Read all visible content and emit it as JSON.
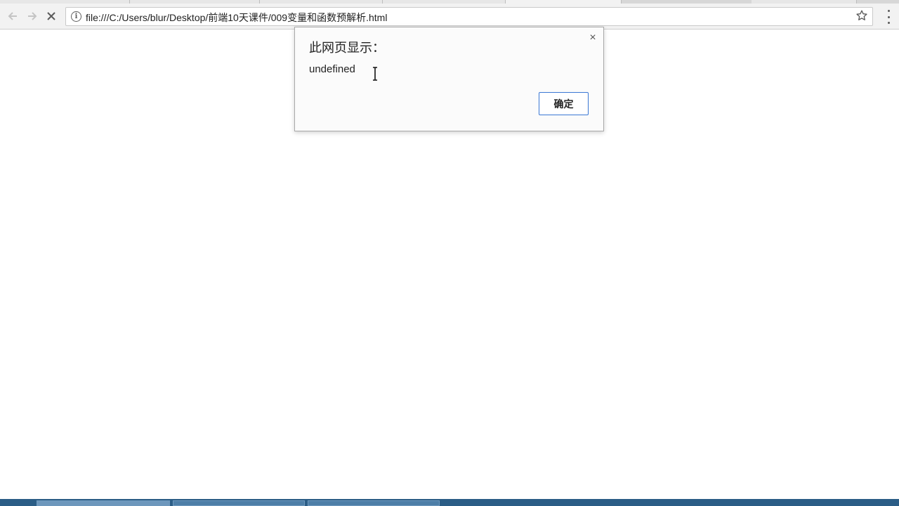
{
  "browser": {
    "url": "file:///C:/Users/blur/Desktop/前端10天课件/009变量和函数预解析.html",
    "back_icon": "back-arrow-icon",
    "forward_icon": "forward-arrow-icon",
    "stop_icon": "stop-loading-icon",
    "info_icon": "info-icon",
    "bookmark_icon": "star-icon",
    "menu_icon": "kebab-menu-icon"
  },
  "dialog": {
    "title": "此网页显示：",
    "message": "undefined",
    "ok_label": "确定",
    "close_glyph": "×",
    "accent_color": "#3a77d4"
  },
  "colors": {
    "taskbar": "#2b5d86",
    "toolbar": "#f2f2f2"
  }
}
